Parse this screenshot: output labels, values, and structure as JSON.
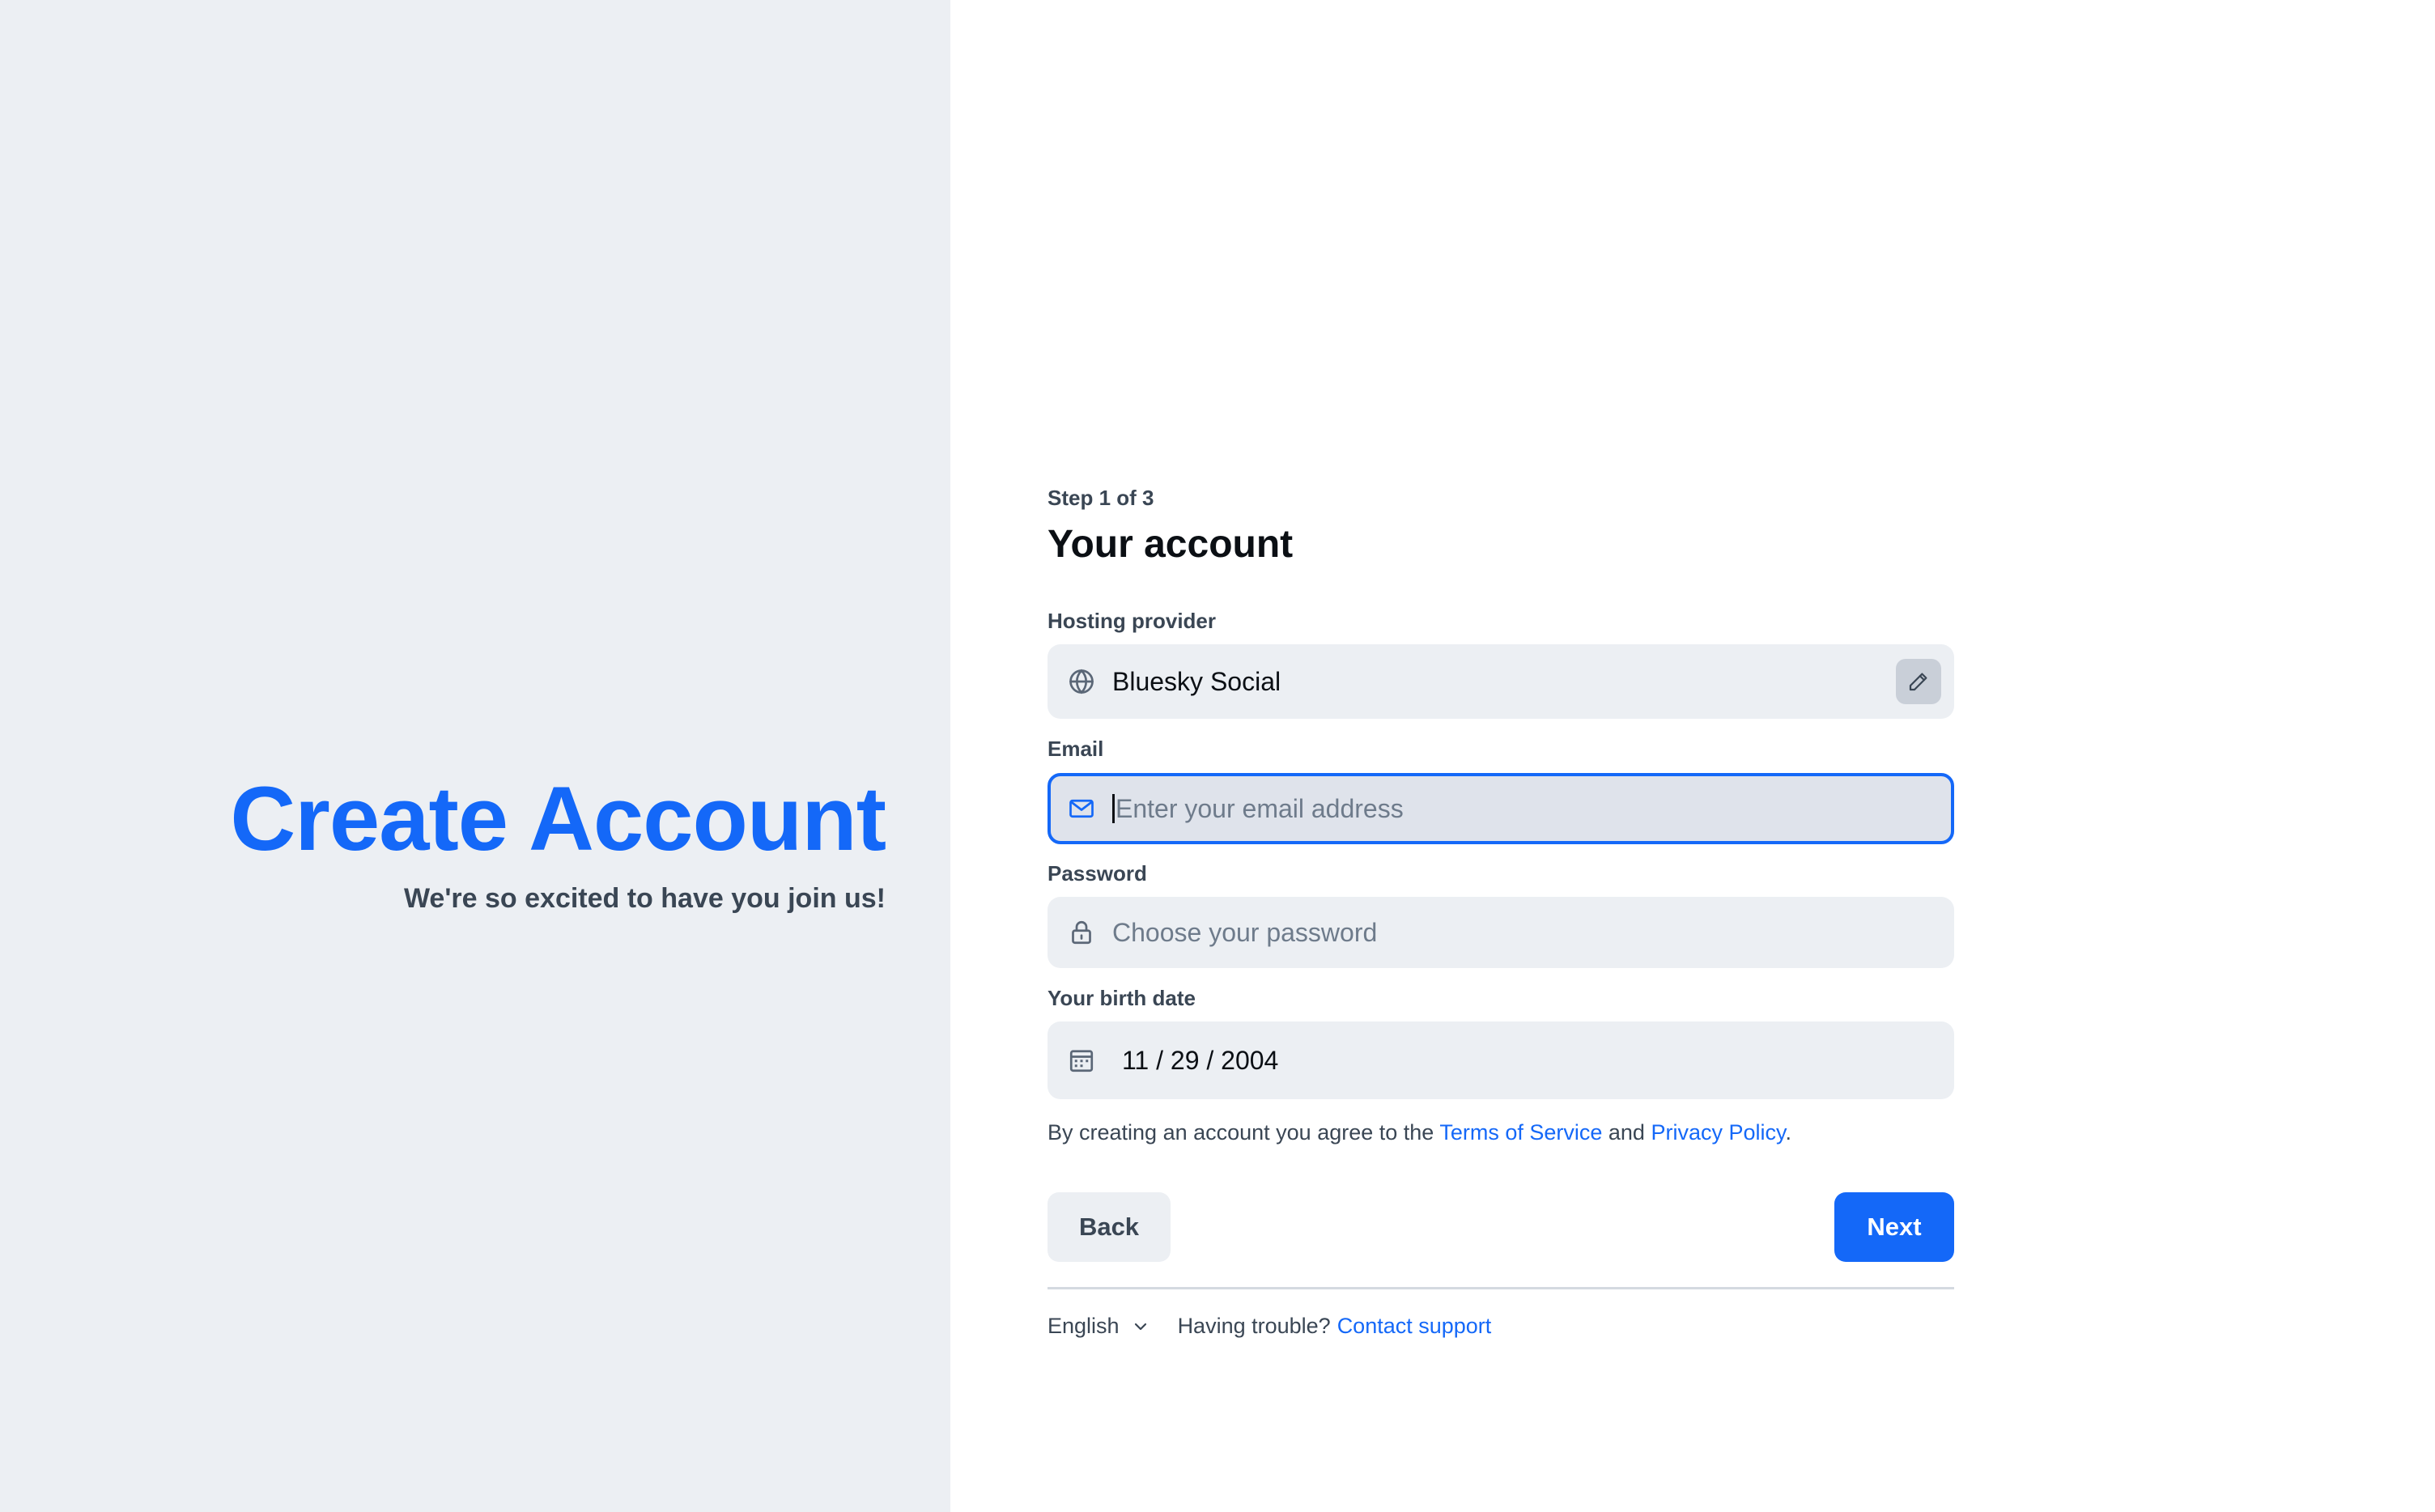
{
  "hero": {
    "title": "Create Account",
    "subtitle": "We're so excited to have you join us!"
  },
  "form": {
    "step": "Step 1 of 3",
    "title": "Your account",
    "hosting": {
      "label": "Hosting provider",
      "value": "Bluesky Social",
      "icon": "globe-icon",
      "action_icon": "pencil-icon"
    },
    "email": {
      "label": "Email",
      "placeholder": "Enter your email address",
      "value": "",
      "icon": "envelope-icon"
    },
    "password": {
      "label": "Password",
      "placeholder": "Choose your password",
      "value": "",
      "icon": "lock-icon"
    },
    "birthdate": {
      "label": "Your birth date",
      "value": "11 / 29 / 2004",
      "icon": "calendar-icon"
    },
    "legal": {
      "prefix": "By creating an account you agree to the ",
      "terms": "Terms of Service",
      "and": " and ",
      "privacy": "Privacy Policy",
      "suffix": "."
    },
    "buttons": {
      "back": "Back",
      "next": "Next"
    }
  },
  "footer": {
    "language": "English",
    "trouble": "Having trouble?",
    "support": "Contact support"
  },
  "colors": {
    "accent": "#1468F8",
    "left_panel_bg": "#ECEFF3",
    "field_bg": "#ECEFF3",
    "text_muted": "#3A4654"
  }
}
